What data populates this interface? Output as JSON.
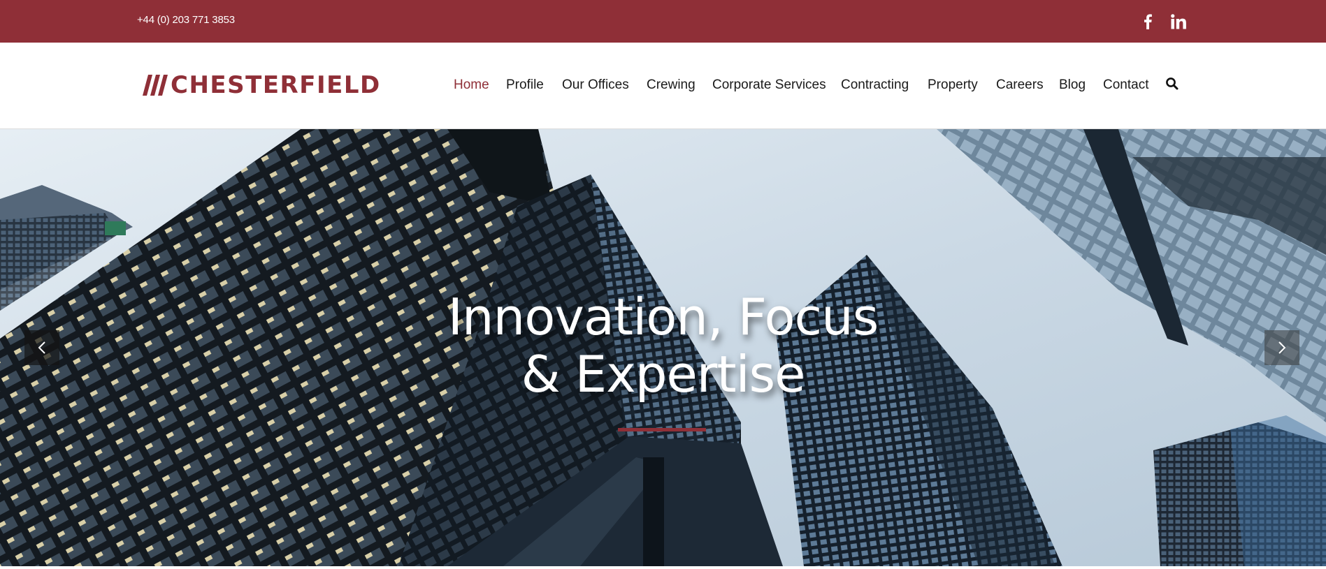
{
  "topbar": {
    "phone": "+44 (0) 203 771 3853",
    "social": [
      {
        "icon": "facebook-icon"
      },
      {
        "icon": "linkedin-icon"
      }
    ],
    "background_color": "#8f2f37"
  },
  "header": {
    "logo_text": "CHESTERFIELD",
    "brand_color": "#8f2f37",
    "nav": [
      {
        "label": "Home",
        "active": true
      },
      {
        "label": "Profile"
      },
      {
        "label": "Our Offices"
      },
      {
        "label": "Crewing"
      },
      {
        "label": "Corporate Services"
      },
      {
        "label": "Contracting"
      },
      {
        "label": "Property"
      },
      {
        "label": "Careers"
      },
      {
        "label": "Blog"
      },
      {
        "label": "Contact"
      }
    ],
    "search_icon": "search-icon"
  },
  "hero": {
    "title_line1": "Innovation, Focus",
    "title_line2": "& Expertise",
    "prev_icon": "chevron-left-icon",
    "next_icon": "chevron-right-icon"
  }
}
